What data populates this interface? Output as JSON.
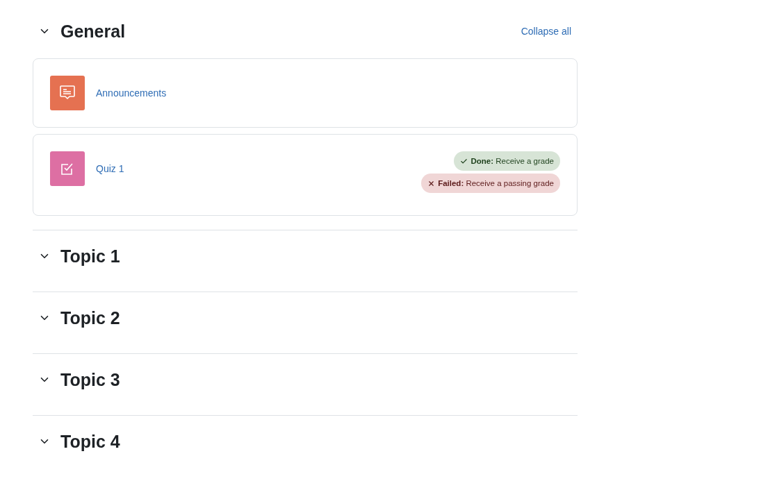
{
  "collapse_all": "Collapse all",
  "sections": [
    {
      "title": "General",
      "expanded": true,
      "activities": [
        {
          "kind": "forum",
          "name": "Announcements"
        },
        {
          "kind": "quiz",
          "name": "Quiz 1",
          "badges": [
            {
              "kind": "done",
              "text": "**Done:** Receive a grade"
            },
            {
              "kind": "failed",
              "text": "**Failed:** Receive a passing grade"
            }
          ]
        }
      ]
    },
    {
      "title": "Topic 1",
      "expanded": true
    },
    {
      "title": "Topic 2",
      "expanded": true
    },
    {
      "title": "Topic 3",
      "expanded": true
    },
    {
      "title": "Topic 4",
      "expanded": true
    }
  ]
}
